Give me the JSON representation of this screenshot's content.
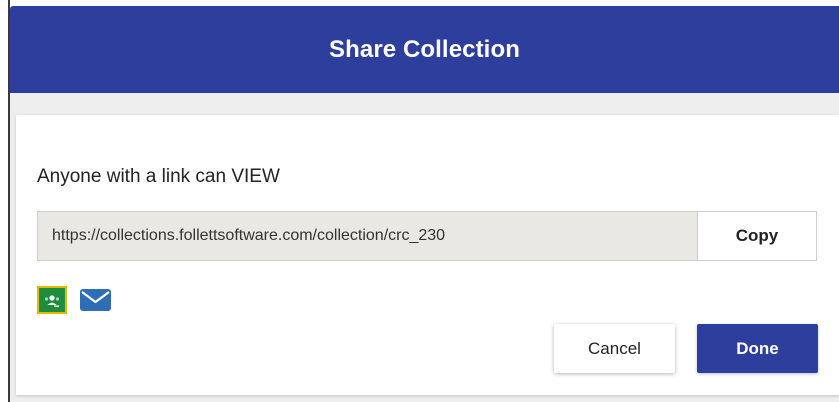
{
  "dialog": {
    "title": "Share Collection",
    "permission_text": "Anyone with a link can VIEW",
    "link_url": "https://collections.follettsoftware.com/collection/crc_230",
    "copy_label": "Copy",
    "share_icons": [
      "google-classroom-icon",
      "email-icon"
    ],
    "cancel_label": "Cancel",
    "done_label": "Done"
  },
  "colors": {
    "header_bg": "#2e3e9c",
    "done_bg": "#2e3e9c",
    "link_field_bg": "#e9e8e2",
    "classroom_green": "#1e8e3e",
    "classroom_border": "#e8b800",
    "email_blue": "#2f6db5"
  }
}
